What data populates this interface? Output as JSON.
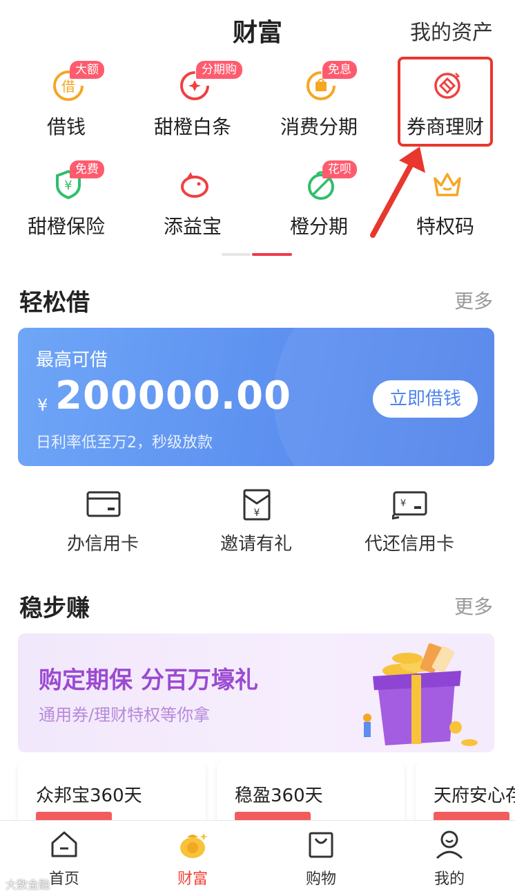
{
  "header": {
    "title": "财富",
    "assets_link": "我的资产"
  },
  "grid": {
    "items": [
      {
        "label": "借钱",
        "badge": "大额",
        "icon": "borrow-icon"
      },
      {
        "label": "甜橙白条",
        "badge": "分期购",
        "icon": "baitiao-icon"
      },
      {
        "label": "消费分期",
        "badge": "免息",
        "icon": "shopping-bag-icon"
      },
      {
        "label": "券商理财",
        "badge": "",
        "icon": "broker-icon"
      },
      {
        "label": "甜橙保险",
        "badge": "免费",
        "icon": "shield-icon"
      },
      {
        "label": "添益宝",
        "badge": "",
        "icon": "piggy-bank-icon"
      },
      {
        "label": "橙分期",
        "badge": "花呗",
        "icon": "orange-installment-icon"
      },
      {
        "label": "特权码",
        "badge": "",
        "icon": "crown-icon"
      }
    ]
  },
  "easy_borrow": {
    "title": "轻松借",
    "more": "更多",
    "card": {
      "label": "最高可借",
      "currency": "¥",
      "amount": "200000.00",
      "sub": "日利率低至万2，秒级放款",
      "button": "立即借钱"
    }
  },
  "quick_actions": [
    {
      "label": "办信用卡",
      "icon": "credit-card-icon"
    },
    {
      "label": "邀请有礼",
      "icon": "red-envelope-icon"
    },
    {
      "label": "代还信用卡",
      "icon": "repay-card-icon"
    }
  ],
  "steady_earn": {
    "title": "稳步赚",
    "more": "更多",
    "promo": {
      "title": "购定期保 分百万壕礼",
      "sub": "通用券/理财特权等你拿"
    },
    "products": [
      {
        "name": "众邦宝360天"
      },
      {
        "name": "稳盈360天"
      },
      {
        "name": "天府安心存"
      }
    ]
  },
  "tabbar": {
    "tabs": [
      {
        "label": "首页",
        "icon": "home-icon",
        "active": false
      },
      {
        "label": "财富",
        "icon": "wealth-bag-icon",
        "active": true
      },
      {
        "label": "购物",
        "icon": "shopping-bag-icon",
        "active": false
      },
      {
        "label": "我的",
        "icon": "profile-icon",
        "active": false
      }
    ]
  },
  "watermark": "大数金融",
  "colors": {
    "accent": "#f04236",
    "card_blue": "#5b8eef",
    "promo_purple": "#9b4ad1",
    "badge": "#ff5b6e"
  }
}
